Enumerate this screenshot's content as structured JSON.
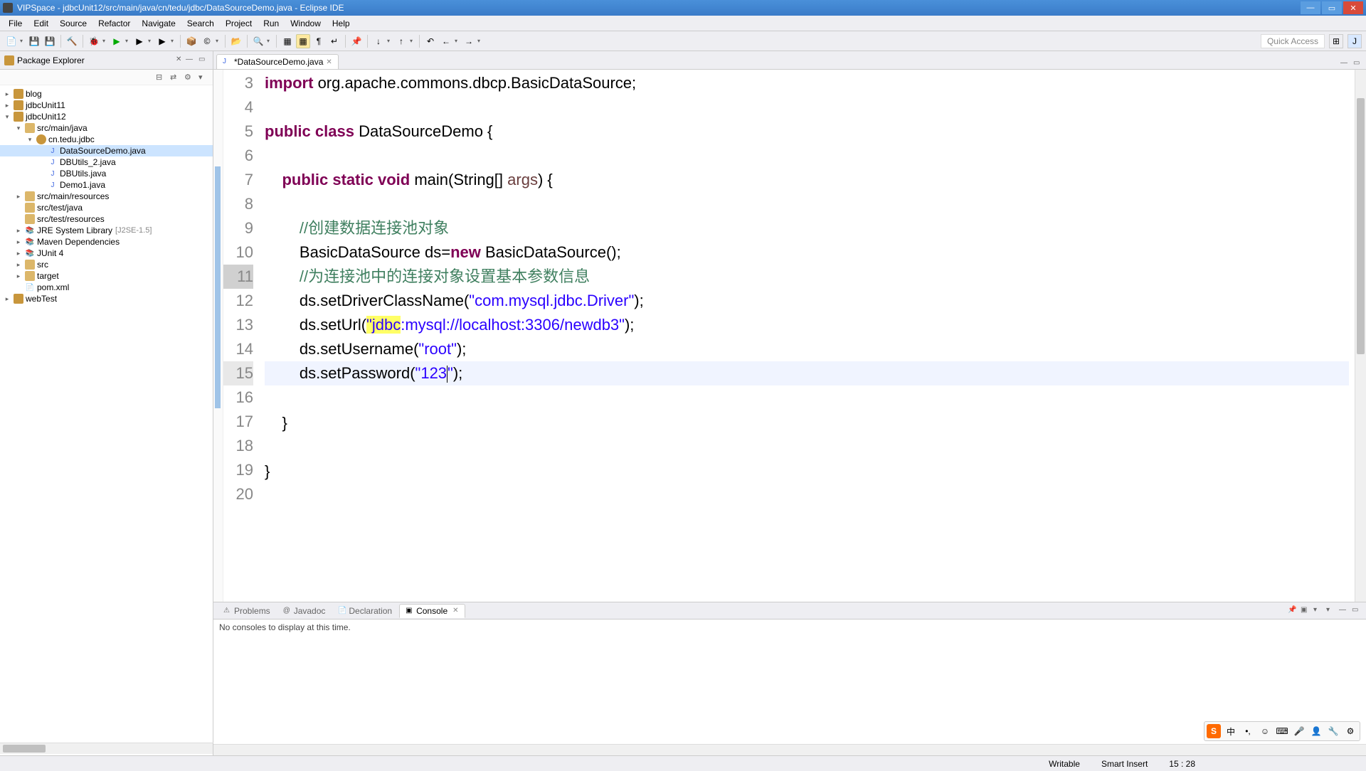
{
  "window": {
    "title": "VIPSpace - jdbcUnit12/src/main/java/cn/tedu/jdbc/DataSourceDemo.java - Eclipse IDE"
  },
  "menu": {
    "file": "File",
    "edit": "Edit",
    "source": "Source",
    "refactor": "Refactor",
    "navigate": "Navigate",
    "search": "Search",
    "project": "Project",
    "run": "Run",
    "window": "Window",
    "help": "Help"
  },
  "toolbar": {
    "quick_access": "Quick Access"
  },
  "package_explorer": {
    "title": "Package Explorer",
    "tree": {
      "blog": "blog",
      "jdbcUnit11": "jdbcUnit11",
      "jdbcUnit12": "jdbcUnit12",
      "src_main_java": "src/main/java",
      "pkg": "cn.tedu.jdbc",
      "file1": "DataSourceDemo.java",
      "file2": "DBUtils_2.java",
      "file3": "DBUtils.java",
      "file4": "Demo1.java",
      "src_main_resources": "src/main/resources",
      "src_test_java": "src/test/java",
      "src_test_resources": "src/test/resources",
      "jre": "JRE System Library",
      "jre_ver": "[J2SE-1.5]",
      "maven": "Maven Dependencies",
      "junit": "JUnit 4",
      "src": "src",
      "target": "target",
      "pom": "pom.xml",
      "webTest": "webTest"
    }
  },
  "editor": {
    "tab_title": "*DataSourceDemo.java",
    "lines": {
      "3": "3",
      "4": "4",
      "5": "5",
      "6": "6",
      "7": "7",
      "8": "8",
      "9": "9",
      "10": "10",
      "11": "11",
      "12": "12",
      "13": "13",
      "14": "14",
      "15": "15",
      "16": "16",
      "17": "17",
      "18": "18",
      "19": "19",
      "20": "20"
    },
    "code": {
      "l3_kw": "import",
      "l3_rest": " org.apache.commons.dbcp.BasicDataSource;",
      "l5_kw1": "public",
      "l5_kw2": "class",
      "l5_name": " DataSourceDemo {",
      "l7_kw1": "public",
      "l7_kw2": "static",
      "l7_kw3": "void",
      "l7_name": " main(String[] ",
      "l7_args": "args",
      "l7_end": ") {",
      "l9_cmt": "//创建数据连接池对象",
      "l10_a": "BasicDataSource ds=",
      "l10_kw": "new",
      "l10_b": " BasicDataSource();",
      "l11_cmt": "//为连接池中的连接对象设置基本参数信息",
      "l12_a": "ds.setDriverClassName(",
      "l12_str": "\"com.mysql.jdbc.Driver\"",
      "l12_b": ");",
      "l13_a": "ds.setUrl(",
      "l13_q": "\"",
      "l13_hl": "jdbc",
      "l13_rest": ":mysql://localhost:3306/newdb3\"",
      "l13_b": ");",
      "l14_a": "ds.setUsername(",
      "l14_str": "\"root\"",
      "l14_b": ");",
      "l15_a": "ds.setPassword(",
      "l15_str": "\"123\"",
      "l15_b": ");",
      "l17": "}",
      "l19": "}"
    }
  },
  "bottom": {
    "problems": "Problems",
    "javadoc": "Javadoc",
    "declaration": "Declaration",
    "console": "Console",
    "empty": "No consoles to display at this time."
  },
  "status": {
    "writable": "Writable",
    "insert": "Smart Insert",
    "pos": "15 : 28"
  },
  "ime": {
    "sogou": "S",
    "cn": "中",
    "punct": "•,",
    "emoji": "☺",
    "kbd": "⌨",
    "mic": "🎤",
    "person": "👤",
    "tool": "🔧",
    "gear": "⚙"
  }
}
